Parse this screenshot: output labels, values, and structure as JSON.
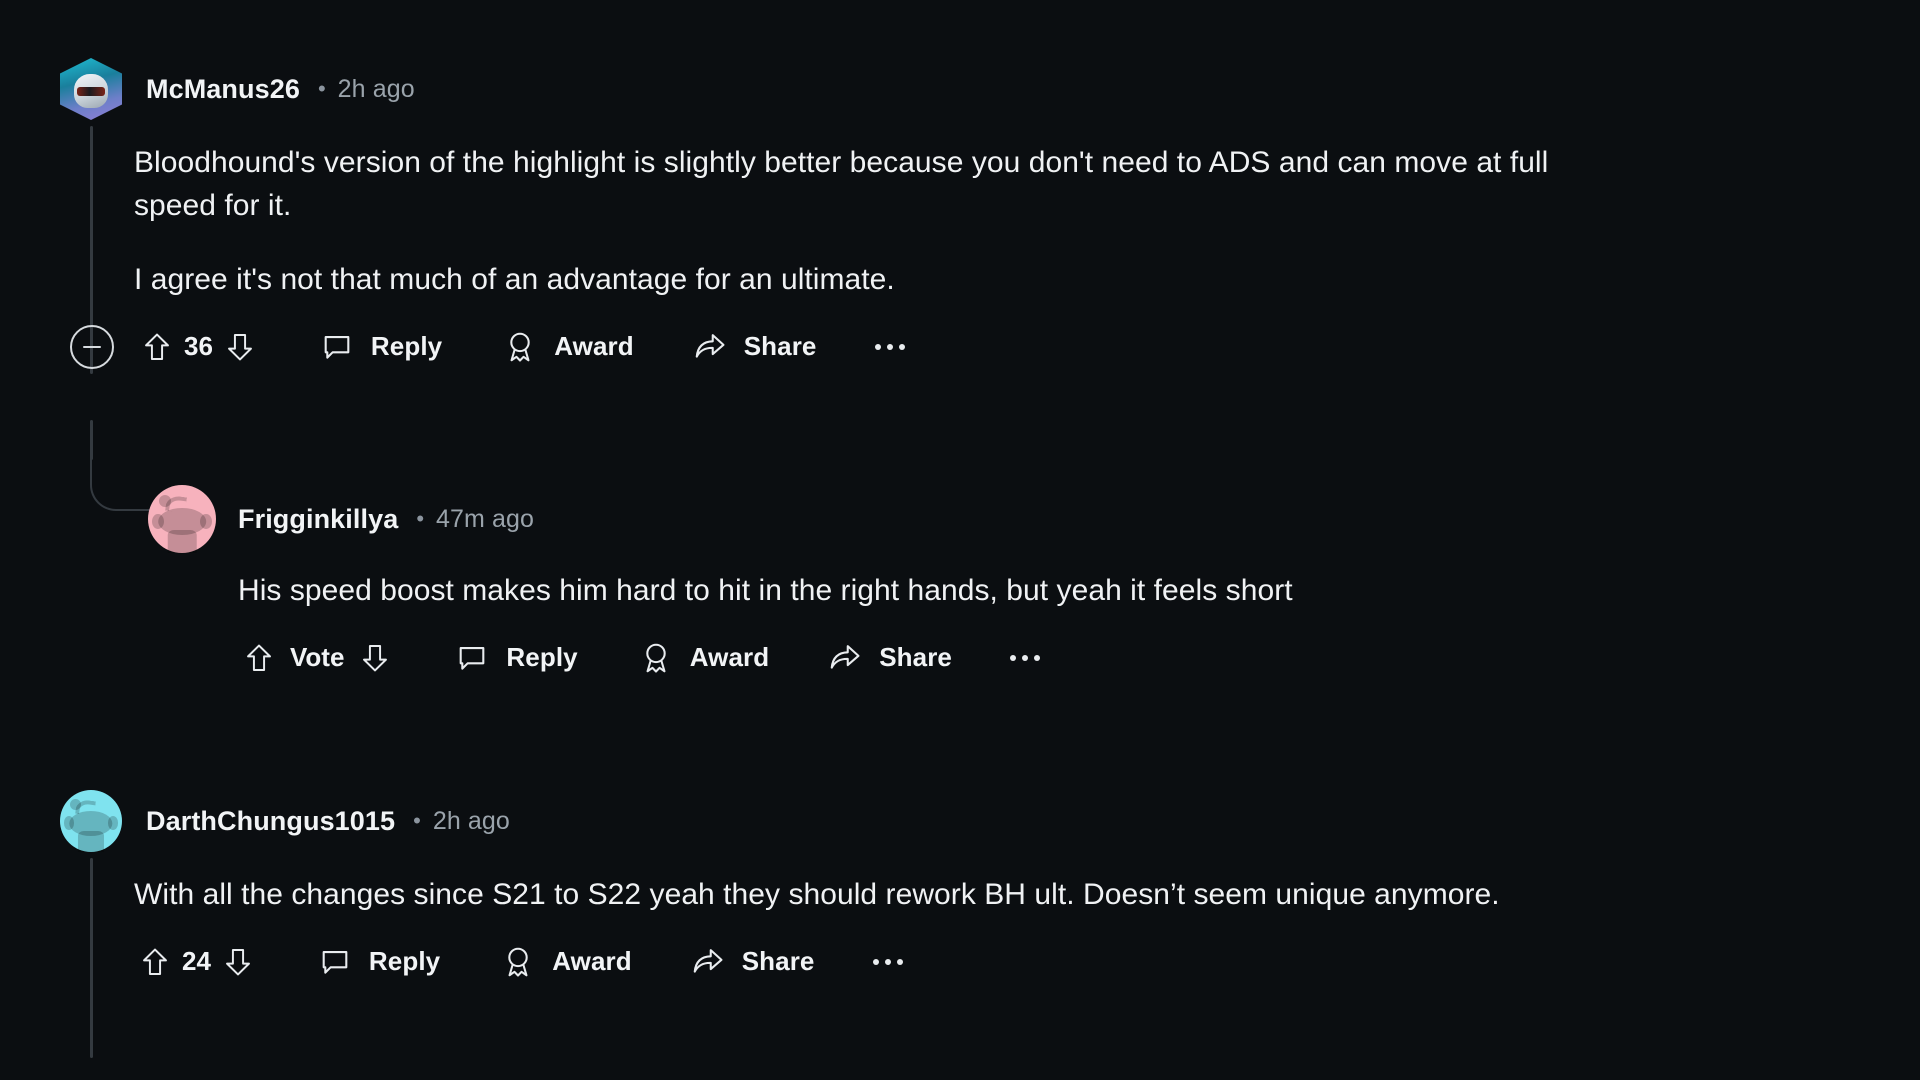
{
  "theme": {
    "background": "#0b0e11",
    "text_primary": "#f0f2f4",
    "text_muted": "#9aa3ab",
    "thread_line": "#343a40"
  },
  "comments": [
    {
      "id": "comment-1",
      "author": "McManus26",
      "separator": "•",
      "timestamp": "2h ago",
      "avatar": "hex-gamer-avatar",
      "paragraphs": [
        "Bloodhound's version of the highlight is slightly better because you don't need to ADS and can move at full speed for it.",
        "I agree it's not that much of an advantage for an ultimate."
      ],
      "score": "36",
      "actions": {
        "collapse": "collapse-thread",
        "upvote": "upvote",
        "downvote": "downvote",
        "reply": "Reply",
        "award": "Award",
        "share": "Share",
        "more": "more-options"
      }
    },
    {
      "id": "comment-2",
      "author": "Frigginkillya",
      "separator": "•",
      "timestamp": "47m ago",
      "avatar": "snoo-pink-avatar",
      "paragraphs": [
        "His speed boost makes him hard to hit in the right hands, but yeah it feels short"
      ],
      "score": "Vote",
      "actions": {
        "upvote": "upvote",
        "downvote": "downvote",
        "reply": "Reply",
        "award": "Award",
        "share": "Share",
        "more": "more-options"
      }
    },
    {
      "id": "comment-3",
      "author": "DarthChungus1015",
      "separator": "•",
      "timestamp": "2h ago",
      "avatar": "snoo-cyan-avatar",
      "paragraphs": [
        "With all the changes since S21 to S22 yeah they should rework BH ult. Doesn’t seem unique anymore."
      ],
      "score": "24",
      "actions": {
        "upvote": "upvote",
        "downvote": "downvote",
        "reply": "Reply",
        "award": "Award",
        "share": "Share",
        "more": "more-options"
      }
    }
  ]
}
